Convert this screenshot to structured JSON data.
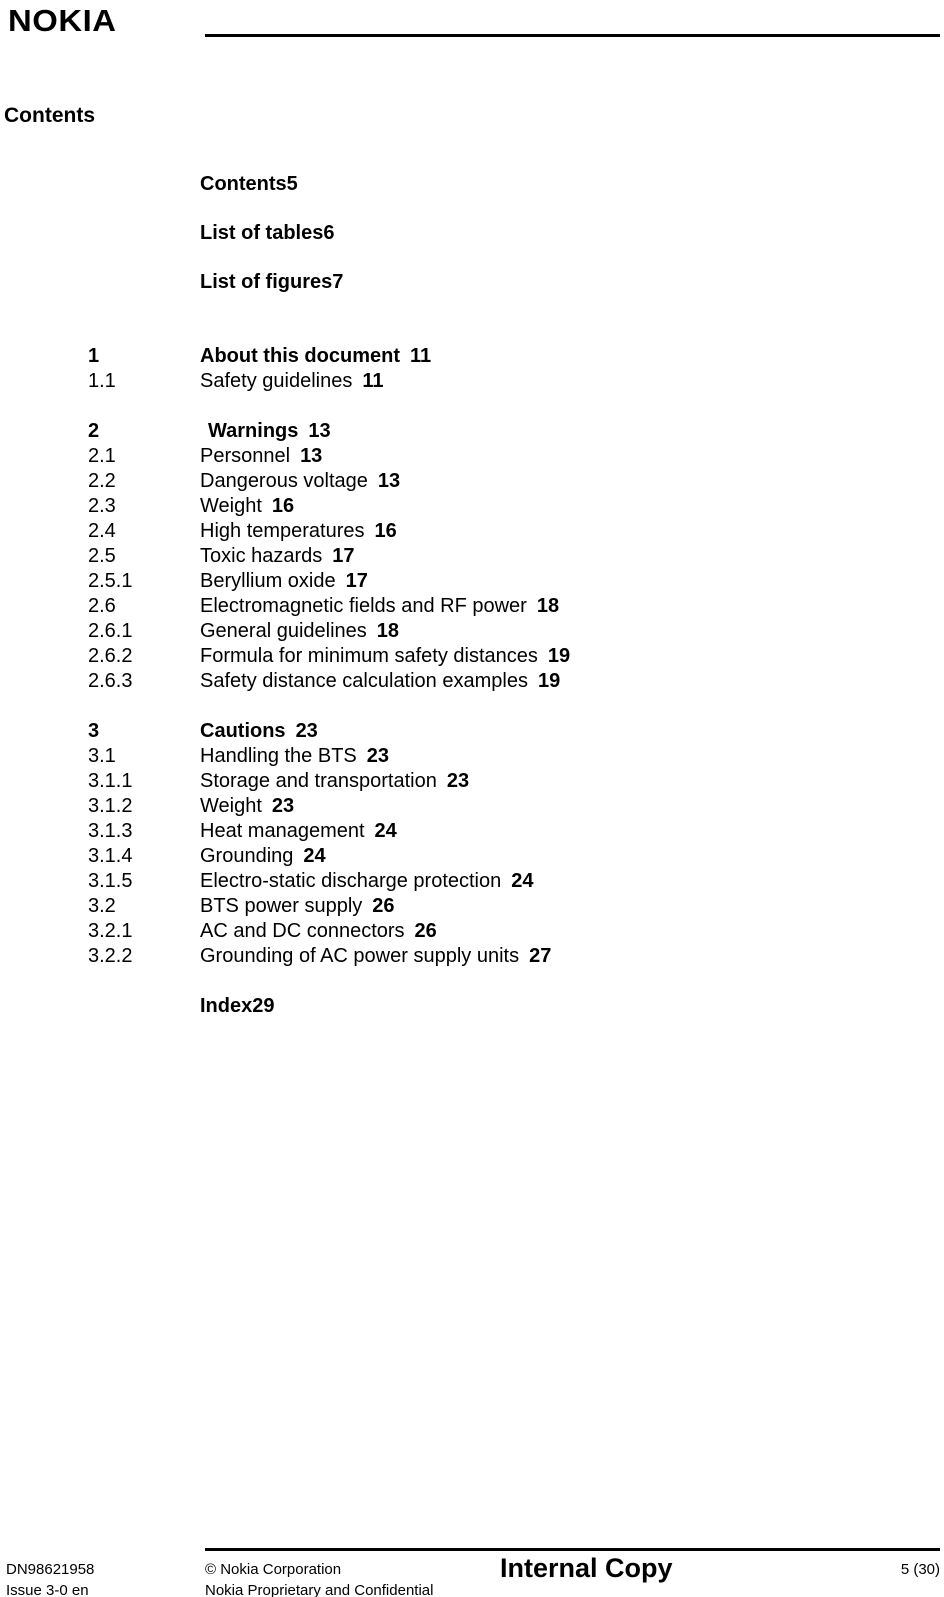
{
  "header": {
    "logo_text": "NOKIA"
  },
  "page_title": "Contents",
  "toc": {
    "front_matter": [
      {
        "title": "Contents",
        "page": "5"
      },
      {
        "title": "List of tables",
        "page": "6"
      },
      {
        "title": "List of figures",
        "page": "7"
      }
    ],
    "groups": [
      {
        "rows": [
          {
            "num": "1",
            "title": "About this document",
            "page": "11",
            "level": "chapter"
          },
          {
            "num": "1.1",
            "title": "Safety guidelines",
            "page": "11",
            "level": "section"
          }
        ]
      },
      {
        "rows": [
          {
            "num": "2",
            "title": "Warnings",
            "page": "13",
            "level": "chapter",
            "indent_title": true
          },
          {
            "num": "2.1",
            "title": "Personnel",
            "page": "13",
            "level": "section"
          },
          {
            "num": "2.2",
            "title": "Dangerous voltage",
            "page": "13",
            "level": "section"
          },
          {
            "num": "2.3",
            "title": "Weight",
            "page": "16",
            "level": "section"
          },
          {
            "num": "2.4",
            "title": "High temperatures",
            "page": "16",
            "level": "section"
          },
          {
            "num": "2.5",
            "title": "Toxic hazards",
            "page": "17",
            "level": "section"
          },
          {
            "num": "2.5.1",
            "title": "Beryllium oxide",
            "page": "17",
            "level": "section"
          },
          {
            "num": "2.6",
            "title": "Electromagnetic fields and RF power",
            "page": "18",
            "level": "section"
          },
          {
            "num": "2.6.1",
            "title": "General guidelines",
            "page": "18",
            "level": "section"
          },
          {
            "num": "2.6.2",
            "title": "Formula for minimum safety distances",
            "page": "19",
            "level": "section"
          },
          {
            "num": "2.6.3",
            "title": "Safety distance calculation examples",
            "page": "19",
            "level": "section"
          }
        ]
      },
      {
        "rows": [
          {
            "num": "3",
            "title": "Cautions",
            "page": "23",
            "level": "chapter"
          },
          {
            "num": "3.1",
            "title": "Handling the BTS",
            "page": "23",
            "level": "section"
          },
          {
            "num": "3.1.1",
            "title": "Storage and transportation",
            "page": "23",
            "level": "section"
          },
          {
            "num": "3.1.2",
            "title": "Weight",
            "page": "23",
            "level": "section"
          },
          {
            "num": "3.1.3",
            "title": "Heat management",
            "page": "24",
            "level": "section"
          },
          {
            "num": "3.1.4",
            "title": "Grounding",
            "page": "24",
            "level": "section"
          },
          {
            "num": "3.1.5",
            "title": "Electro-static discharge protection",
            "page": "24",
            "level": "section"
          },
          {
            "num": "3.2",
            "title": "BTS power supply",
            "page": "26",
            "level": "section"
          },
          {
            "num": "3.2.1",
            "title": "AC and DC connectors",
            "page": "26",
            "level": "section"
          },
          {
            "num": "3.2.2",
            "title": "Grounding of AC power supply units",
            "page": "27",
            "level": "section"
          }
        ]
      }
    ],
    "index": {
      "title": "Index",
      "page": "29"
    }
  },
  "footer": {
    "doc_id": "DN98621958",
    "issue": "Issue 3-0 en",
    "copyright": "© Nokia Corporation",
    "confidentiality": "Nokia Proprietary and Confidential",
    "classification": "Internal Copy",
    "page_number": "5 (30)"
  }
}
